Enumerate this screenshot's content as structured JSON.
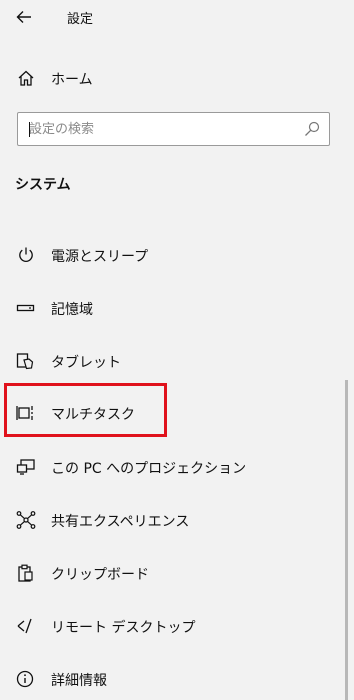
{
  "header": {
    "title": "設定"
  },
  "home": {
    "label": "ホーム"
  },
  "search": {
    "placeholder": "設定の検索"
  },
  "section": {
    "title": "システム"
  },
  "nav": {
    "items": [
      {
        "label": "電源とスリープ",
        "icon": "power-icon"
      },
      {
        "label": "記憶域",
        "icon": "storage-icon"
      },
      {
        "label": "タブレット",
        "icon": "tablet-icon"
      },
      {
        "label": "マルチタスク",
        "icon": "multitasking-icon"
      },
      {
        "label": "この PC へのプロジェクション",
        "icon": "projection-icon"
      },
      {
        "label": "共有エクスペリエンス",
        "icon": "shared-experiences-icon"
      },
      {
        "label": "クリップボード",
        "icon": "clipboard-icon"
      },
      {
        "label": "リモート デスクトップ",
        "icon": "remote-desktop-icon"
      },
      {
        "label": "詳細情報",
        "icon": "info-icon"
      }
    ]
  },
  "colors": {
    "highlight": "#e0121c",
    "background": "#f2f2f2"
  }
}
